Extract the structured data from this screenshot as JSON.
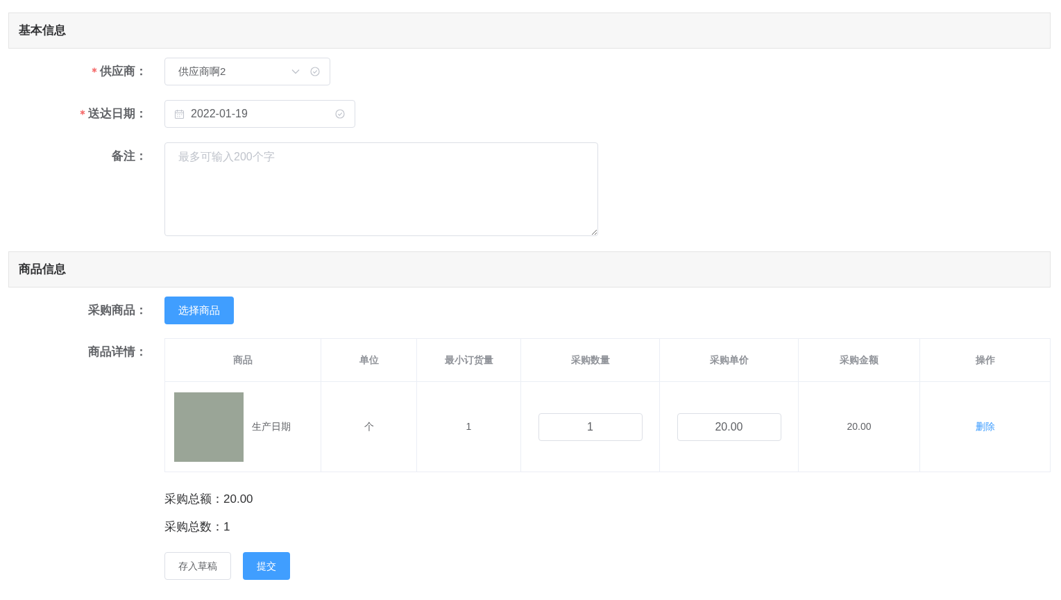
{
  "basic_info": {
    "title": "基本信息",
    "fields": [
      {
        "kind": "select",
        "label": "供应商：",
        "required": true,
        "value": "供应商啊2"
      },
      {
        "kind": "date",
        "label": "送达日期：",
        "required": true,
        "value": "2022-01-19"
      },
      {
        "kind": "textarea",
        "label": "备注：",
        "required": false,
        "placeholder": "最多可输入200个字"
      }
    ]
  },
  "goods_info": {
    "title": "商品信息",
    "select_label": "采购商品：",
    "select_button": "选择商品",
    "details_label": "商品详情：",
    "table": {
      "columns": [
        "商品",
        "单位",
        "最小订货量",
        "采购数量",
        "采购单价",
        "采购金额",
        "操作"
      ],
      "rows": [
        {
          "product": "生产日期",
          "unit": "个",
          "min_order": "1",
          "quantity": "1",
          "unit_price": "20.00",
          "amount": "20.00",
          "action": "删除"
        }
      ]
    },
    "totals": [
      {
        "label": "采购总额：",
        "value": "20.00"
      },
      {
        "label": "采购总数：",
        "value": "1"
      }
    ],
    "buttons": [
      {
        "label": "存入草稿",
        "kind": "default"
      },
      {
        "label": "提交",
        "kind": "primary"
      }
    ]
  }
}
